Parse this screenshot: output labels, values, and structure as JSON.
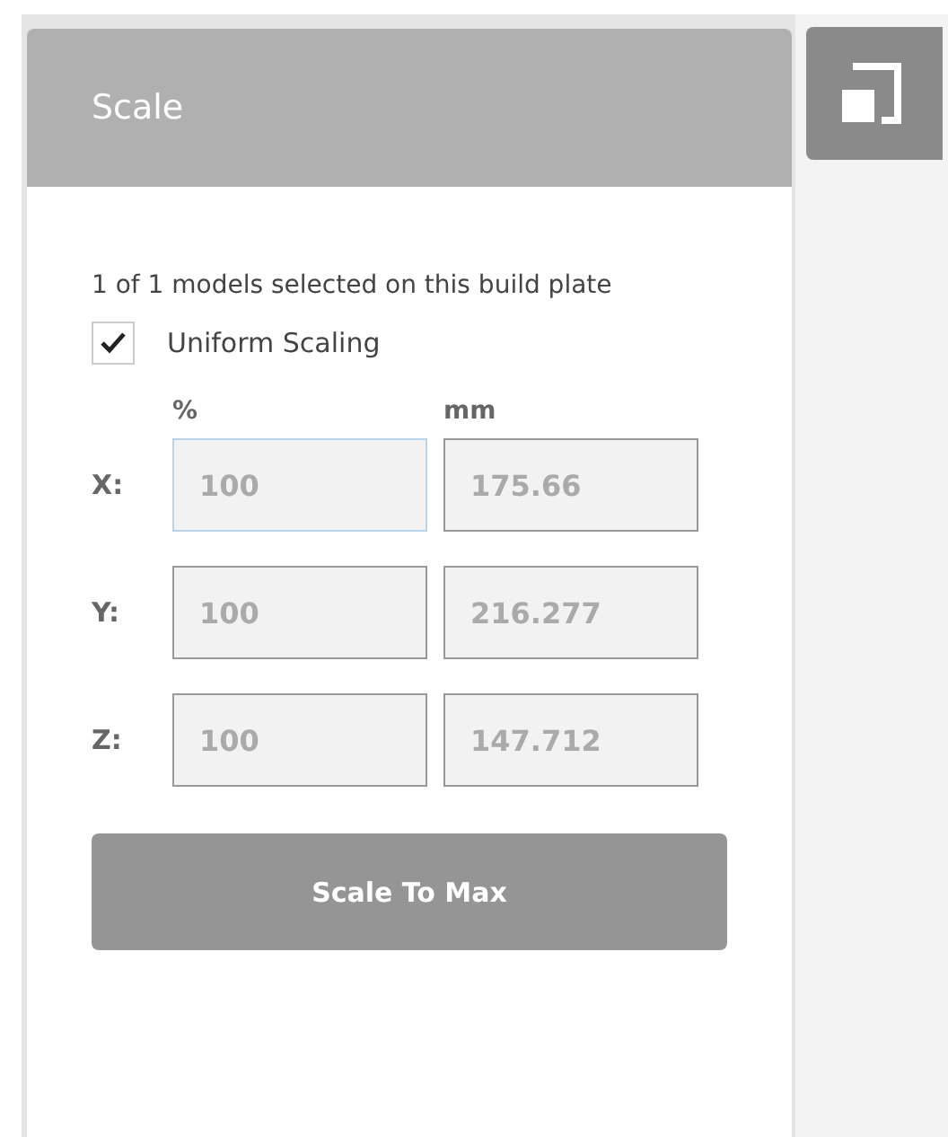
{
  "panel": {
    "title": "Scale",
    "info": "1 of 1 models selected on this build plate",
    "uniform_scaling": {
      "label": "Uniform Scaling",
      "checked": true
    },
    "columns": [
      "%",
      "mm"
    ],
    "rows": [
      {
        "axis": "X:",
        "percent": {
          "value": "100",
          "focused": true
        },
        "mm": {
          "value": "175.66",
          "focused": false
        }
      },
      {
        "axis": "Y:",
        "percent": {
          "value": "100",
          "focused": false
        },
        "mm": {
          "value": "216.277",
          "focused": false
        }
      },
      {
        "axis": "Z:",
        "percent": {
          "value": "100",
          "focused": false
        },
        "mm": {
          "value": "147.712",
          "focused": false
        }
      }
    ],
    "button": "Scale To Max"
  }
}
